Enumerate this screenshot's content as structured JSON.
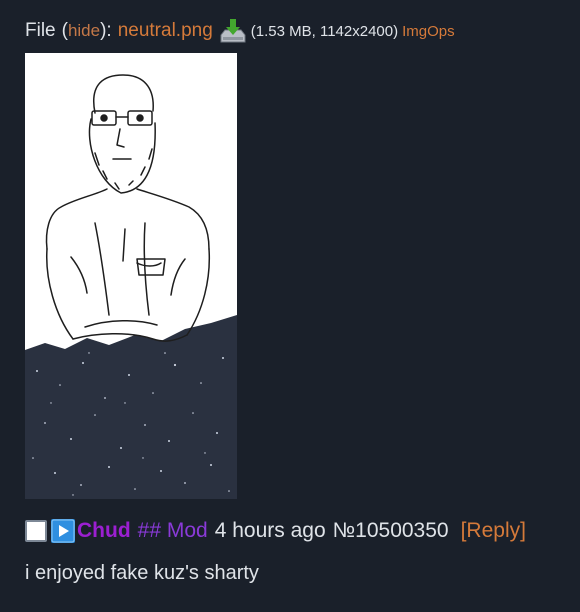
{
  "file": {
    "prefix": "File",
    "paren_open": "(",
    "hide_label": "hide",
    "paren_close": "):",
    "filename": "neutral.png",
    "meta": "(1.53 MB, 1142x2400)",
    "imgops_label": "ImgOps",
    "download_icon": "download-icon"
  },
  "post": {
    "name": "Chud",
    "capcode": "## Mod",
    "time": "4 hours ago",
    "number": "№10500350",
    "reply_label": "[Reply]",
    "message": "i enjoyed fake kuz's sharty",
    "play_icon": "play-icon"
  },
  "colors": {
    "background": "#1a202a",
    "link": "#d57a3a",
    "name": "#9b1fd1",
    "capcode": "#8a3ad8",
    "text": "#dfe3e8"
  }
}
